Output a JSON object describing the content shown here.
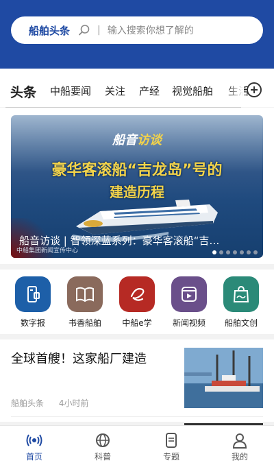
{
  "search": {
    "brand": "船舶头条",
    "separator": "|",
    "placeholder": "输入搜索你想了解的"
  },
  "tabs": [
    "头条",
    "中船要闻",
    "关注",
    "产经",
    "视觉船舶",
    "生活"
  ],
  "banner": {
    "logo_part1": "船音",
    "logo_part2": "访谈",
    "title_line1": "豪华客滚船“吉龙岛”号的",
    "title_line2": "建造历程",
    "caption": "船音访谈 | 智领深蓝系列：豪华客滚船“吉…",
    "watermark": "中船集团新闻宣传中心",
    "slide_count": 7,
    "active_slide": 1
  },
  "shortcuts": [
    {
      "label": "数字报",
      "icon": "digital-paper-icon",
      "color": "#1d5fa8"
    },
    {
      "label": "书香船舶",
      "icon": "book-icon",
      "color": "#8a6a5c"
    },
    {
      "label": "中船e学",
      "icon": "e-learning-icon",
      "color": "#b62a24"
    },
    {
      "label": "新闻视频",
      "icon": "video-icon",
      "color": "#6a4f8a"
    },
    {
      "label": "船舶文创",
      "icon": "shopping-bag-icon",
      "color": "#2b8a78"
    }
  ],
  "news": [
    {
      "title": "全球首艘！这家船厂建造",
      "source": "船舶头条",
      "time": "4小时前"
    }
  ],
  "nav": [
    "首页",
    "科普",
    "专题",
    "我的"
  ],
  "colors": {
    "brand": "#1f4aa3"
  }
}
